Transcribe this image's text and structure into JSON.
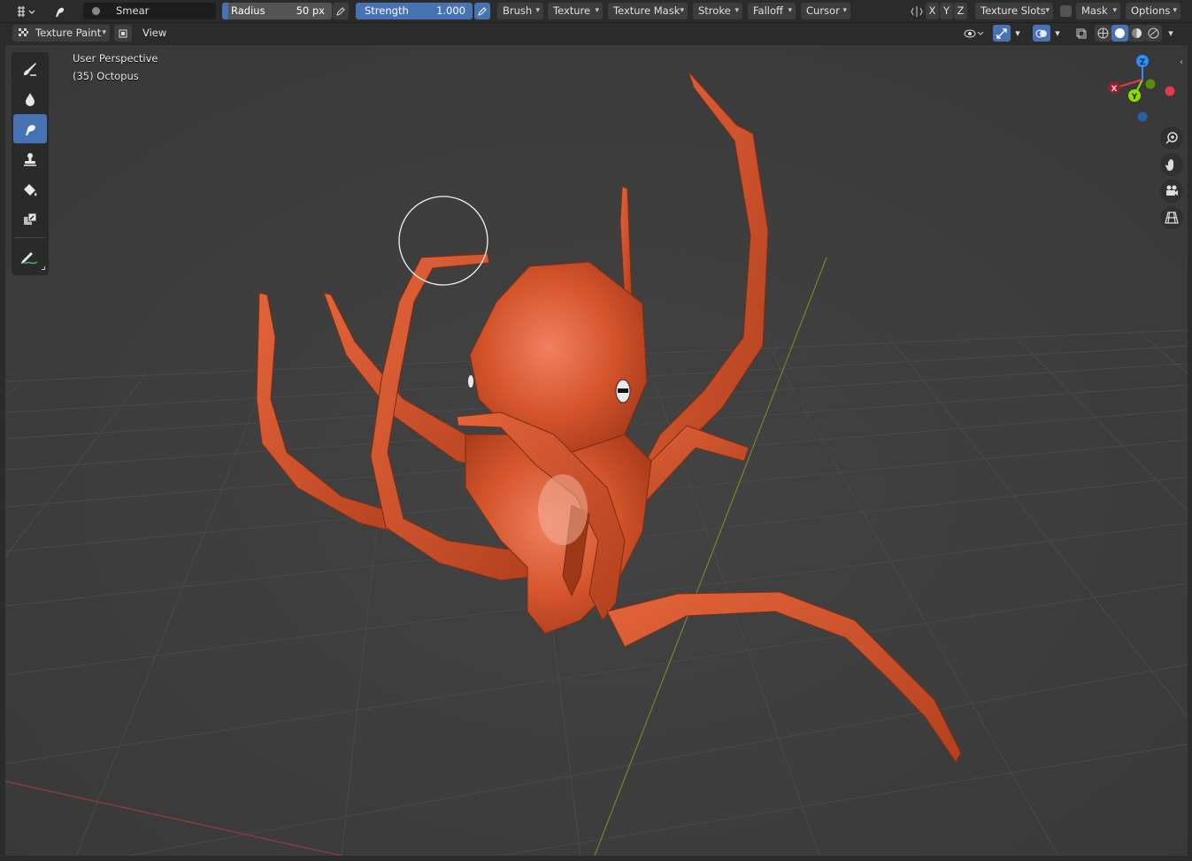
{
  "header": {
    "brush_name": "Smear",
    "radius": {
      "label": "Radius",
      "value": "50 px"
    },
    "strength": {
      "label": "Strength",
      "value": "1.000",
      "fraction": 1.0
    },
    "menus": [
      "Brush",
      "Texture",
      "Texture Mask",
      "Stroke",
      "Falloff",
      "Cursor"
    ],
    "mirror_axes": [
      "X",
      "Y",
      "Z"
    ],
    "texture_slots_label": "Texture Slots",
    "mask_label": "Mask",
    "options_label": "Options"
  },
  "view_header": {
    "mode_label": "Texture Paint",
    "view_label": "View"
  },
  "viewport": {
    "perspective_label": "User Perspective",
    "object_label": "(35) Octopus"
  },
  "gizmo": {
    "x_label": "X",
    "y_label": "Y",
    "z_label": "Z",
    "colors": {
      "x": "#e8384f",
      "y": "#8bdc00",
      "z": "#2890ff"
    }
  },
  "tools": [
    {
      "name": "draw",
      "icon": "paint-brush-icon",
      "active": false
    },
    {
      "name": "soften",
      "icon": "drop-icon",
      "active": false
    },
    {
      "name": "smear",
      "icon": "smear-icon",
      "active": true
    },
    {
      "name": "clone",
      "icon": "stamp-icon",
      "active": false
    },
    {
      "name": "fill",
      "icon": "fill-bucket-icon",
      "active": false
    },
    {
      "name": "mask",
      "icon": "mask-icon",
      "active": false
    },
    {
      "name": "annotate",
      "icon": "annotate-icon",
      "active": false
    }
  ],
  "colors": {
    "accent": "#4772b3",
    "octopus": "#d2512a",
    "grid": "#474747",
    "axis_x": "#9b3a44",
    "axis_y": "#6e8a2a"
  }
}
